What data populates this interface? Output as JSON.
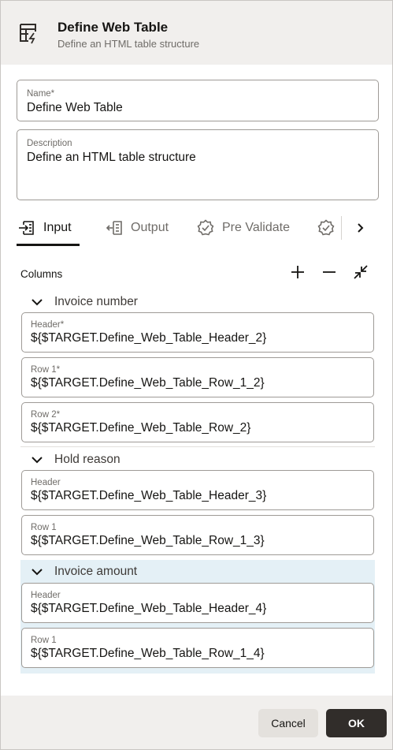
{
  "header": {
    "title": "Define Web Table",
    "subtitle": "Define an HTML table structure",
    "icon": "table-lightning-icon"
  },
  "form": {
    "name": {
      "label": "Name*",
      "value": "Define Web Table"
    },
    "description": {
      "label": "Description",
      "value": "Define an HTML table structure"
    }
  },
  "tabs": [
    {
      "label": "Input",
      "icon": "input-icon",
      "active": true
    },
    {
      "label": "Output",
      "icon": "output-icon",
      "active": false
    },
    {
      "label": "Pre Validate",
      "icon": "badge-check-icon",
      "active": false
    },
    {
      "label": "",
      "icon": "badge-check-icon",
      "active": false
    }
  ],
  "columns": {
    "label": "Columns",
    "groups": [
      {
        "label": "Invoice number",
        "fields": [
          {
            "label": "Header*",
            "value": "${$TARGET.Define_Web_Table_Header_2}"
          },
          {
            "label": "Row 1*",
            "value": "${$TARGET.Define_Web_Table_Row_1_2}"
          },
          {
            "label": "Row 2*",
            "value": "${$TARGET.Define_Web_Table_Row_2}"
          }
        ]
      },
      {
        "label": "Hold reason",
        "fields": [
          {
            "label": "Header",
            "value": "${$TARGET.Define_Web_Table_Header_3}"
          },
          {
            "label": "Row 1",
            "value": "${$TARGET.Define_Web_Table_Row_1_3}"
          }
        ]
      },
      {
        "label": "Invoice amount",
        "fields": [
          {
            "label": "Header",
            "value": "${$TARGET.Define_Web_Table_Header_4}"
          },
          {
            "label": "Row 1",
            "value": "${$TARGET.Define_Web_Table_Row_1_4}"
          }
        ]
      }
    ]
  },
  "footer": {
    "cancel_label": "Cancel",
    "ok_label": "OK"
  },
  "colors": {
    "header_bg": "#f1efed",
    "primary_button": "#312d2a",
    "selected_group": "#e4f0f6"
  }
}
